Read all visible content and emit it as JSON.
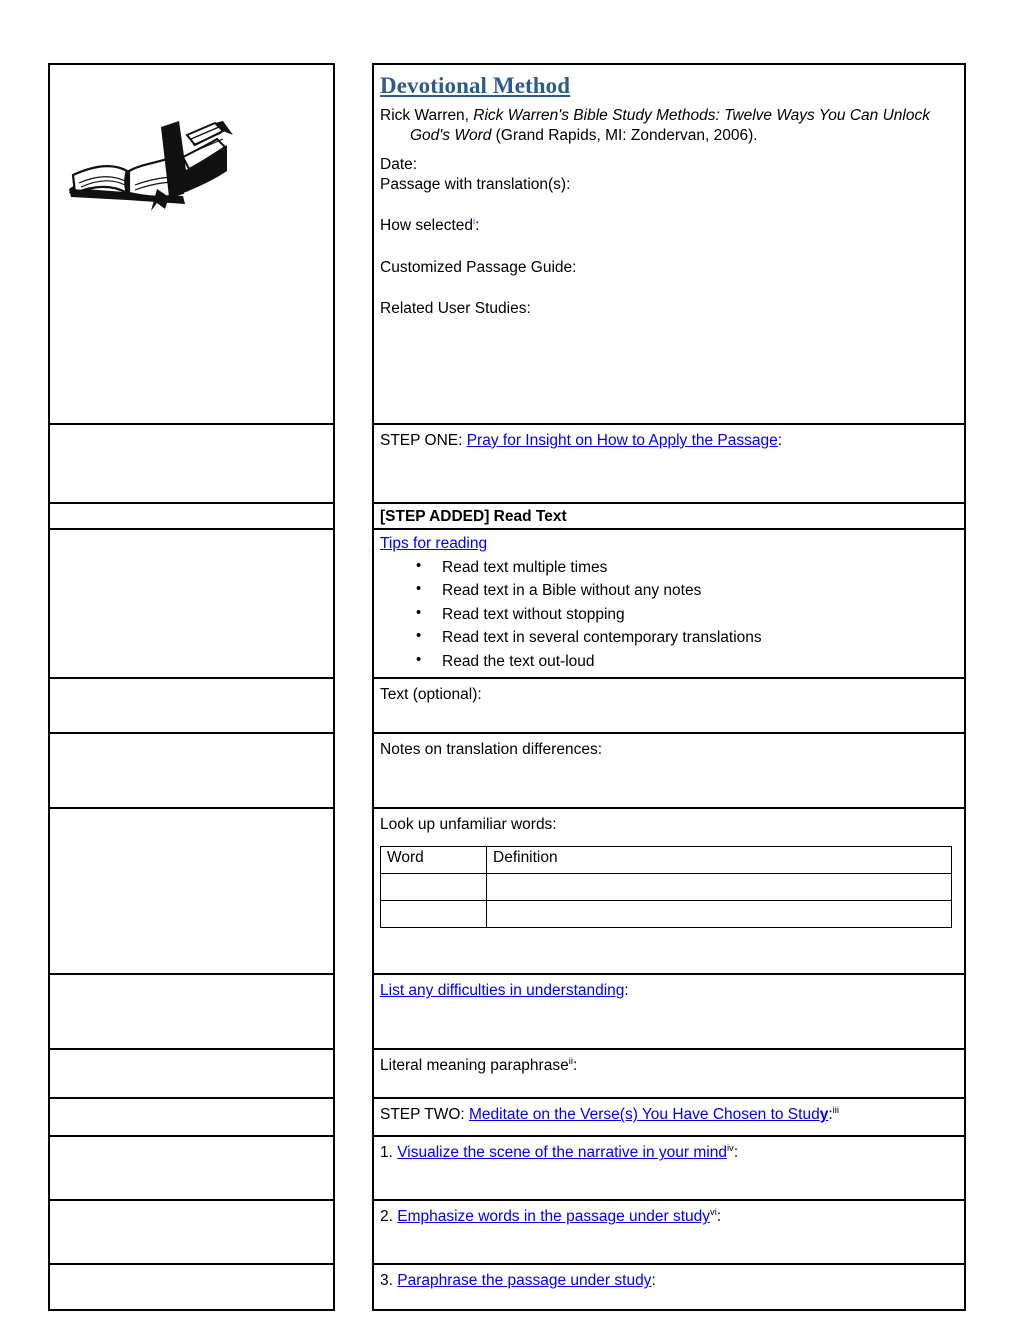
{
  "document": {
    "title": "Devotional Method",
    "citation": {
      "author": "Rick Warren, ",
      "work_italic": "Rick Warren's Bible Study Methods: Twelve Ways You Can Unlock God's Word",
      "publication": " (Grand Rapids, MI: Zondervan, 2006)."
    },
    "header_fields": [
      "Date:",
      "Passage with translation(s):",
      "How selected",
      "Customized Passage Guide:",
      "Related User Studies:"
    ],
    "how_selected_label": "How selected",
    "how_selected_footnote": "i",
    "how_selected_colon": ":",
    "illustration": "open-bible-book-clipart"
  },
  "steps": {
    "step_one": {
      "prefix": "STEP ONE: ",
      "link": "Pray for Insight on How to Apply the Passage",
      "suffix": ":"
    },
    "step_added": {
      "heading": "[STEP ADDED] Read Text",
      "tips_link": "Tips for reading",
      "tips": [
        "Read text multiple times",
        "Read text in a Bible without any notes",
        "Read text without stopping",
        "Read text in several contemporary translations",
        "Read the text out-loud"
      ]
    },
    "text_optional": "Text (optional):",
    "notes_translation": "Notes on translation differences:",
    "look_up_words": "Look up unfamiliar words:",
    "word_table": {
      "headers": [
        "Word",
        "Definition"
      ],
      "rows": [
        [
          "",
          ""
        ],
        [
          "",
          ""
        ]
      ]
    },
    "difficulties": {
      "link": "List any difficulties in understanding",
      "suffix": ":"
    },
    "literal_paraphrase": {
      "label": "Literal meaning paraphrase",
      "footnote": "ii",
      "suffix": ":"
    },
    "step_two": {
      "prefix": "STEP TWO: ",
      "link_main": "Meditate on the Verse(s) You Have Chosen to Stud",
      "link_tail": "y",
      "suffix": ":",
      "footnote": "iii"
    },
    "meditate_items": [
      {
        "number": "1. ",
        "link": "Visualize the scene of the narrative in your mind",
        "footnote": "iv",
        "suffix": ":"
      },
      {
        "number": "2. ",
        "link": "Emphasize words in the passage under study",
        "footnote": "vi",
        "suffix": ":"
      },
      {
        "number": "3. ",
        "link": "Paraphrase the passage under study",
        "footnote": "",
        "suffix": ":"
      }
    ]
  },
  "colors": {
    "title_blue": "#2E5C8A",
    "link_blue": "#0000EE",
    "divider_red": "#FF0000",
    "border_black": "#000000"
  }
}
